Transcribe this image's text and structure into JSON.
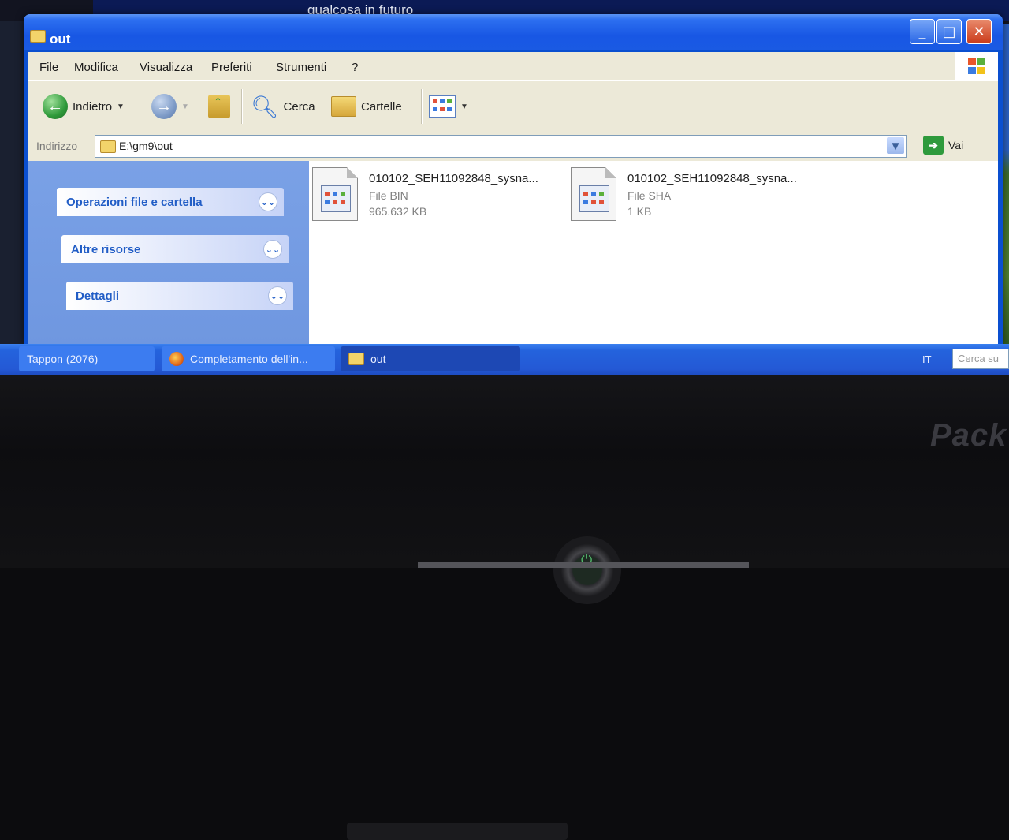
{
  "background": {
    "window_text": "qualcosa in futuro",
    "brand": "Pack"
  },
  "window": {
    "title": "out",
    "controls": {
      "minimize": "_",
      "maximize": "□",
      "close": "✕"
    }
  },
  "menu": [
    "File",
    "Modifica",
    "Visualizza",
    "Preferiti",
    "Strumenti",
    "?"
  ],
  "toolbar": {
    "back_label": "Indietro",
    "search_label": "Cerca",
    "folders_label": "Cartelle"
  },
  "address": {
    "label": "Indirizzo",
    "path": "E:\\gm9\\out",
    "go_label": "Vai"
  },
  "sidebar": {
    "panels": [
      {
        "title": "Operazioni file e cartella"
      },
      {
        "title": "Altre risorse"
      },
      {
        "title": "Dettagli"
      }
    ]
  },
  "files": [
    {
      "name": "010102_SEH11092848_sysna...",
      "type": "File BIN",
      "size": "965.632 KB"
    },
    {
      "name": "010102_SEH11092848_sysna...",
      "type": "File SHA",
      "size": "1 KB"
    }
  ],
  "taskbar": {
    "tasks": [
      {
        "label": "Tappon (2076)"
      },
      {
        "label": "Completamento dell'in..."
      },
      {
        "label": "out"
      }
    ],
    "language": "IT",
    "search_placeholder": "Cerca su"
  }
}
